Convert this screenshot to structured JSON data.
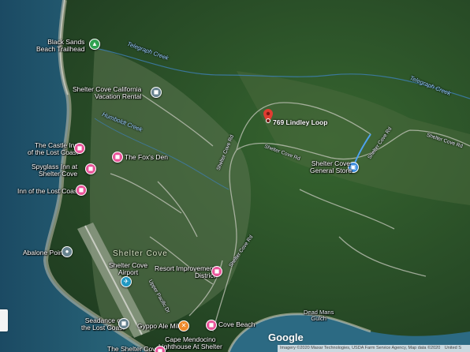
{
  "map": {
    "type": "satellite",
    "colors": {
      "ocean": "#1e4f66",
      "forest": "#2c5a2c",
      "route_blue": "#3f8fdf",
      "pin_red": "#e03c31",
      "poi_pink": "#e9559a",
      "poi_green": "#2fa150"
    }
  },
  "selected_place": {
    "address": "769 Lindley Loop",
    "pin_icon": "red-location-pin-icon"
  },
  "places": {
    "black_sands": {
      "name": "Black Sands Beach Trailhead",
      "line1": "Black Sands",
      "line2": "Beach Trailhead",
      "icon": "hiking-icon"
    },
    "vacation_rental": {
      "line1": "Shelter Cove California",
      "line2": "Vacation Rental",
      "icon": "hotel-icon"
    },
    "castle_inn": {
      "line1": "The Castle Inn",
      "line2": "of the Lost Coast",
      "icon": "hotel-icon"
    },
    "foxs_den": {
      "line1": "The Fox's Den",
      "icon": "hotel-icon"
    },
    "spyglass": {
      "line1": "Spyglass Inn at",
      "line2": "Shelter Cove",
      "icon": "hotel-icon"
    },
    "inn_lost_coast": {
      "line1": "Inn of the Lost Coast",
      "icon": "hotel-icon"
    },
    "general_store": {
      "line1": "Shelter Cove",
      "line2": "General Store",
      "icon": "shopping-bag-icon"
    },
    "abalone_point": {
      "line1": "Abalone Point",
      "icon": "viewpoint-icon"
    },
    "airport": {
      "line1": "Shelter Cove",
      "line2": "Airport",
      "icon": "airplane-icon"
    },
    "resort_district": {
      "line1": "Resort Improvement",
      "line2": "District",
      "icon": "building-icon"
    },
    "seadance": {
      "line1": "Seadance on",
      "line2": "the Lost Coast",
      "icon": "hotel-icon"
    },
    "gyppo": {
      "line1": "Gyppo Ale Mill",
      "icon": "restaurant-icon"
    },
    "cove_beach": {
      "line1": "Cove Beach",
      "icon": "hotel-icon"
    },
    "lighthouse": {
      "line1": "Cape Mendocino",
      "line2": "Lighthouse At Shelter",
      "icon": "landmark-icon"
    },
    "shelter_bottom": {
      "line1": "The Shelter Cove",
      "icon": "hotel-icon"
    }
  },
  "labels": {
    "creeks": [
      "Telegraph Creek",
      "Telegraph Creek",
      "Humboldt Creek"
    ],
    "roads": [
      "Shelter Cove Rd",
      "Shelter Cove Rd",
      "Shelter Cove Rd",
      "Shelter Cove Rd",
      "Upper Pacific Dr"
    ],
    "area": "Shelter Cove",
    "gulch": [
      "Dead Mans",
      "Gulch"
    ]
  },
  "branding": {
    "logo": "Google",
    "attribution": "Imagery ©2020 Maxar Technologies, USDA Farm Service Agency, Map data ©2020",
    "attribution_tail": "United S"
  }
}
